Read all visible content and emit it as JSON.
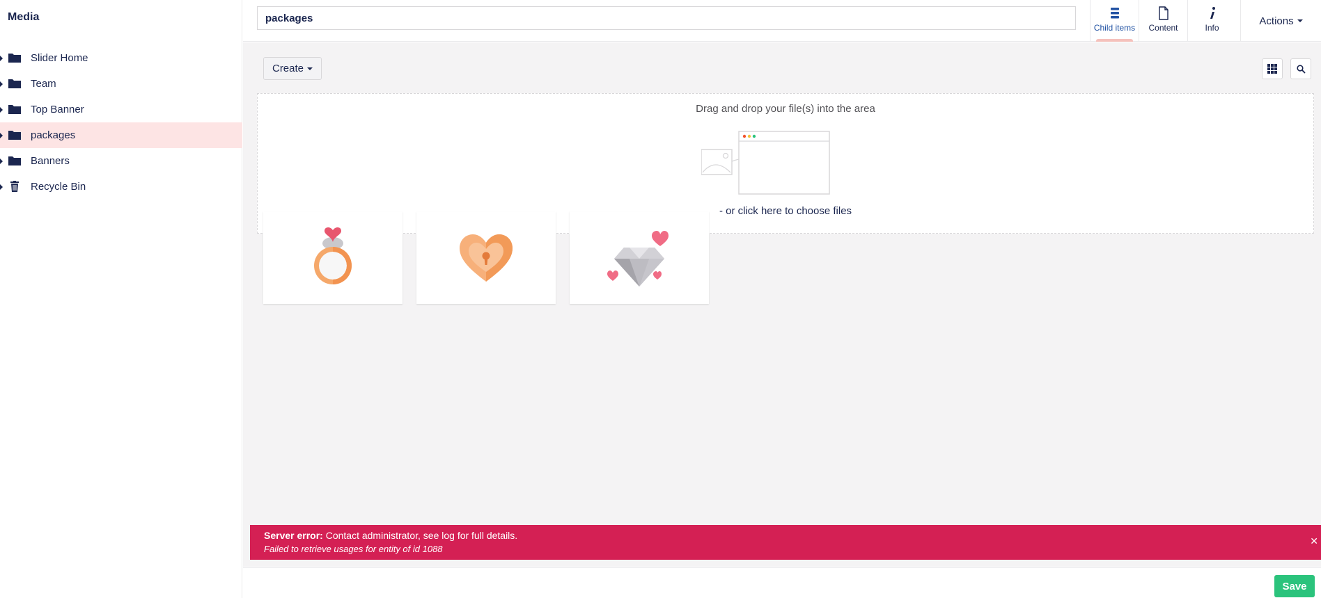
{
  "sidebar": {
    "title": "Media",
    "items": [
      {
        "label": "Slider Home",
        "icon": "folder-icon",
        "active": false
      },
      {
        "label": "Team",
        "icon": "folder-icon",
        "active": false
      },
      {
        "label": "Top Banner",
        "icon": "folder-icon",
        "active": false
      },
      {
        "label": "packages",
        "icon": "folder-icon",
        "active": true
      },
      {
        "label": "Banners",
        "icon": "folder-icon",
        "active": false
      },
      {
        "label": "Recycle Bin",
        "icon": "trash-icon",
        "active": false
      }
    ]
  },
  "header": {
    "name_value": "packages",
    "tabs": [
      {
        "label": "Child items",
        "icon": "list-icon",
        "active": true
      },
      {
        "label": "Content",
        "icon": "document-icon",
        "active": false
      },
      {
        "label": "Info",
        "icon": "info-icon",
        "active": false
      }
    ],
    "actions_label": "Actions"
  },
  "toolbar": {
    "create_label": "Create",
    "grid_icon": "grid-icon",
    "search_icon": "search-icon"
  },
  "dropzone": {
    "drag_text": "Drag and drop your file(s) into the area",
    "choose_text": "- or click here to choose files"
  },
  "media_items": [
    {
      "icon": "ring-icon"
    },
    {
      "icon": "heart-lock-icon"
    },
    {
      "icon": "diamond-icon"
    }
  ],
  "error": {
    "title": "Server error:",
    "message": "Contact administrator, see log for full details.",
    "detail": "Failed to retrieve usages for entity of id 1088",
    "close": "✕"
  },
  "footer": {
    "save_label": "Save"
  },
  "colors": {
    "brand_navy": "#1b264f",
    "active_tree_bg": "#fde4e4",
    "error_bg": "#d42054",
    "save_green": "#2bc37c",
    "main_bg": "#f4f3f4"
  }
}
